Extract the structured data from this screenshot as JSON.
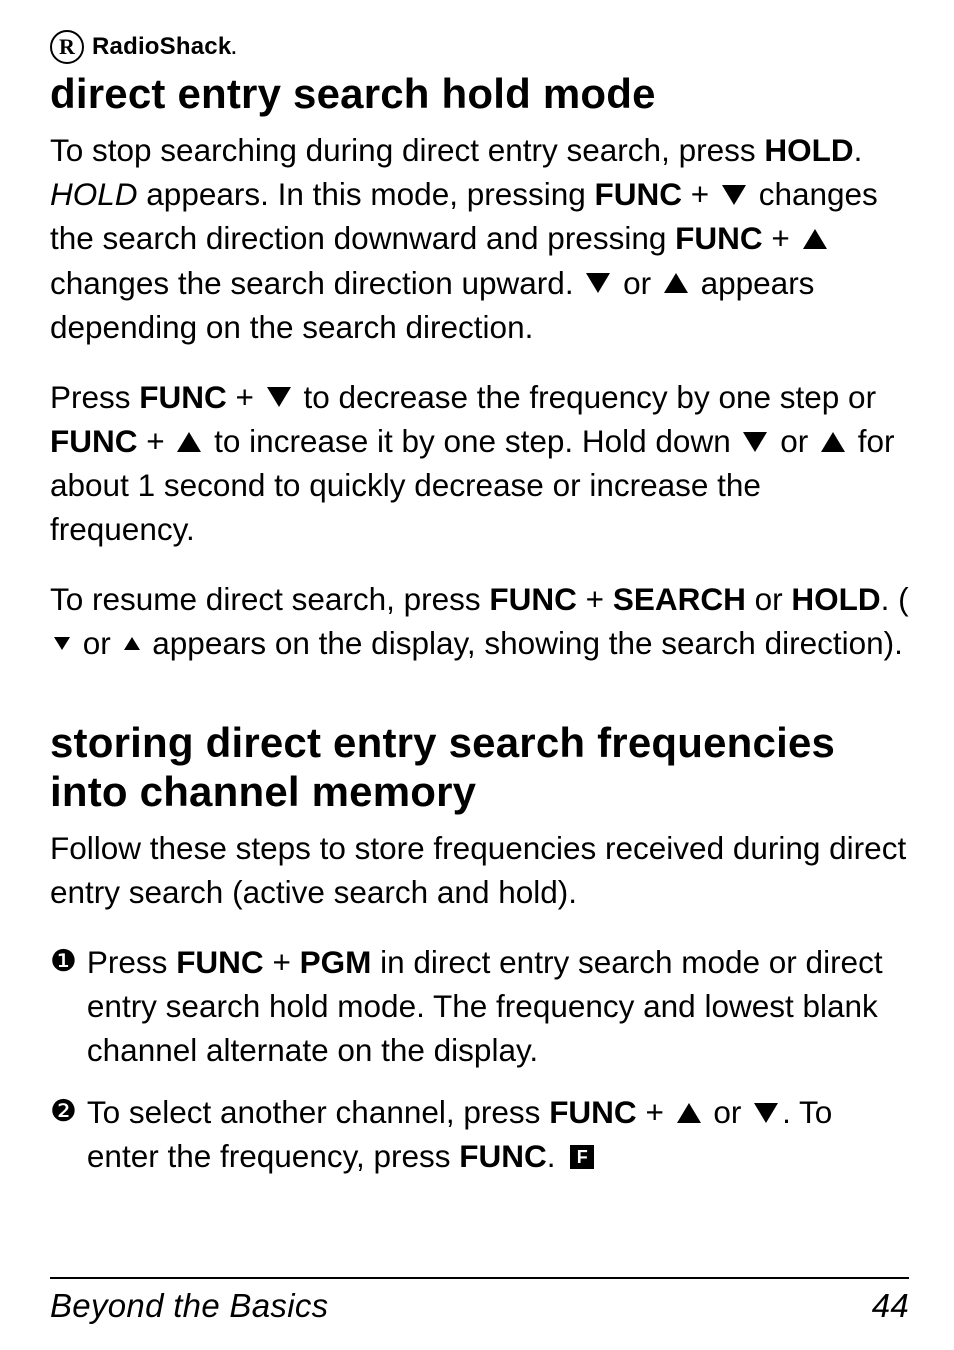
{
  "brand": {
    "mark": "R",
    "name": "RadioShack",
    "trailing_dot": "."
  },
  "section1": {
    "title": "direct entry search hold mode",
    "p1a": "To stop searching during direct entry search, press ",
    "p1_hold": "HOLD",
    "p1b": ". ",
    "p1_hold_it": "HOLD",
    "p1c": " appears. In this mode, pressing ",
    "p1_func1": "FUNC",
    "p1d": " + ",
    "p1e": " changes the search direction downward and pressing ",
    "p1_func2": "FUNC",
    "p1f": " + ",
    "p1g": " changes the search direction upward. ",
    "p1h": " or ",
    "p1i": " appears depending on the search direction.",
    "p2a": "Press ",
    "p2_func1": "FUNC",
    "p2b": " + ",
    "p2c": " to decrease the frequency by one step or ",
    "p2_func2": "FUNC",
    "p2d": " + ",
    "p2e": " to increase it by one step. Hold down ",
    "p2f": " or ",
    "p2g": " for about 1 second to quickly decrease or increase the frequency.",
    "p3a": "To resume direct search, press ",
    "p3_func": "FUNC",
    "p3b": " + ",
    "p3_search": "SEARCH",
    "p3c": " or ",
    "p3_hold": "HOLD",
    "p3d": ". (",
    "p3e": " or ",
    "p3f": " appears on the display, showing the search direction)."
  },
  "section2": {
    "title": "storing direct entry search frequencies into channel memory",
    "intro": "Follow these steps to store frequencies received during direct entry search (active search and hold).",
    "step1_marker": "❶",
    "step1a": "Press ",
    "step1_func": "FUNC",
    "step1b": " + ",
    "step1_pgm": "PGM",
    "step1c": " in direct entry search mode or direct entry search hold mode. The frequency and lowest blank channel alternate on the display.",
    "step2_marker": "❷",
    "step2a": "To select another channel, press ",
    "step2_func1": "FUNC",
    "step2b": " + ",
    "step2c": " or ",
    "step2d": ". To enter the frequency, press ",
    "step2_func2": "FUNC",
    "step2e": ". ",
    "step2_f": "F"
  },
  "footer": {
    "section": "Beyond the Basics",
    "page": "44"
  }
}
